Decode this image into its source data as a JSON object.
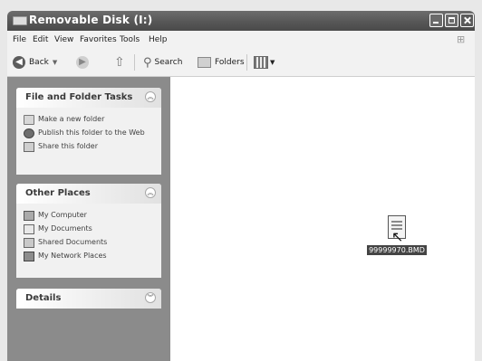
{
  "window": {
    "title": "Removable Disk (I:)"
  },
  "menu": [
    "File",
    "Edit",
    "View",
    "Favorites",
    "Tools",
    "Help"
  ],
  "toolbar": {
    "back": "Back",
    "search": "Search",
    "folders": "Folders"
  },
  "tasks_panel": {
    "title": "File and Folder Tasks",
    "items": [
      "Make a new folder",
      "Publish this folder to the Web",
      "Share this folder"
    ]
  },
  "places_panel": {
    "title": "Other Places",
    "items": [
      "My Computer",
      "My Documents",
      "Shared Documents",
      "My Network Places"
    ]
  },
  "details_panel": {
    "title": "Details"
  },
  "file": {
    "name": "99999970.BMD"
  }
}
